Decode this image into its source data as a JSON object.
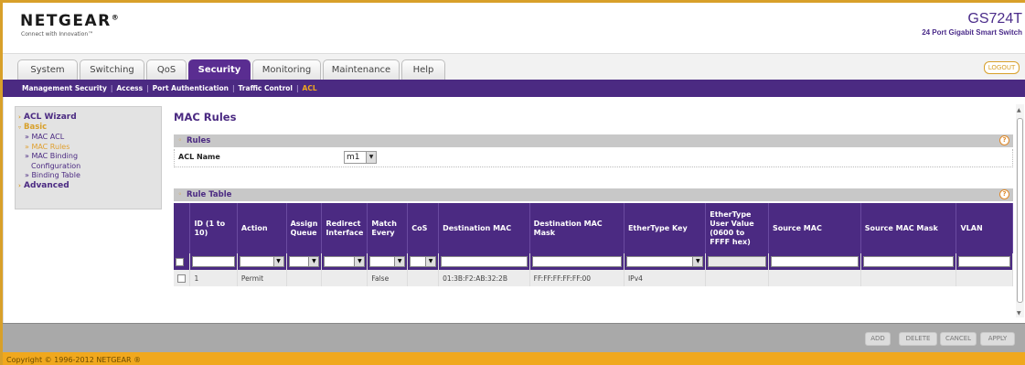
{
  "header": {
    "logo": "NETGEAR",
    "logo_mark": "®",
    "tagline": "Connect with Innovation™",
    "model": "GS724T",
    "model_desc": "24 Port Gigabit Smart Switch"
  },
  "tabs": [
    "System",
    "Switching",
    "QoS",
    "Security",
    "Monitoring",
    "Maintenance",
    "Help"
  ],
  "active_tab": "Security",
  "logout_label": "LOGOUT",
  "subnav": {
    "items": [
      "Management Security",
      "Access",
      "Port Authentication",
      "Traffic Control",
      "ACL"
    ],
    "active": "ACL"
  },
  "sidebar": {
    "acl_wizard": "ACL Wizard",
    "basic": "Basic",
    "items": [
      "» MAC ACL",
      "» MAC Rules",
      "» MAC Binding",
      "Configuration",
      "» Binding Table"
    ],
    "advanced": "Advanced"
  },
  "page_title": "MAC Rules",
  "rules_panel": {
    "title": "Rules",
    "acl_name_label": "ACL Name",
    "acl_name_value": "m1"
  },
  "rule_table": {
    "title": "Rule Table",
    "columns": [
      "ID (1 to 10)",
      "Action",
      "Assign Queue",
      "Redirect Interface",
      "Match Every",
      "CoS",
      "Destination MAC",
      "Destination MAC Mask",
      "EtherType Key",
      "EtherType User Value (0600 to FFFF hex)",
      "Source MAC",
      "Source MAC Mask",
      "VLAN"
    ],
    "rows": [
      {
        "id": "1",
        "action": "Permit",
        "assign_queue": "",
        "redirect_interface": "",
        "match_every": "False",
        "cos": "",
        "destination_mac": "01:3B:F2:AB:32:2B",
        "destination_mac_mask": "FF:FF:FF:FF:FF:00",
        "ethertype_key": "IPv4",
        "ethertype_user_value": "",
        "source_mac": "",
        "source_mac_mask": "",
        "vlan": ""
      }
    ]
  },
  "help_glyph": "?",
  "buttons": {
    "add": "ADD",
    "delete": "DELETE",
    "cancel": "CANCEL",
    "apply": "APPLY"
  },
  "footer": "Copyright © 1996-2012 NETGEAR ®",
  "colors": {
    "brand_purple": "#4b2a82",
    "accent_orange": "#f0a81e"
  }
}
